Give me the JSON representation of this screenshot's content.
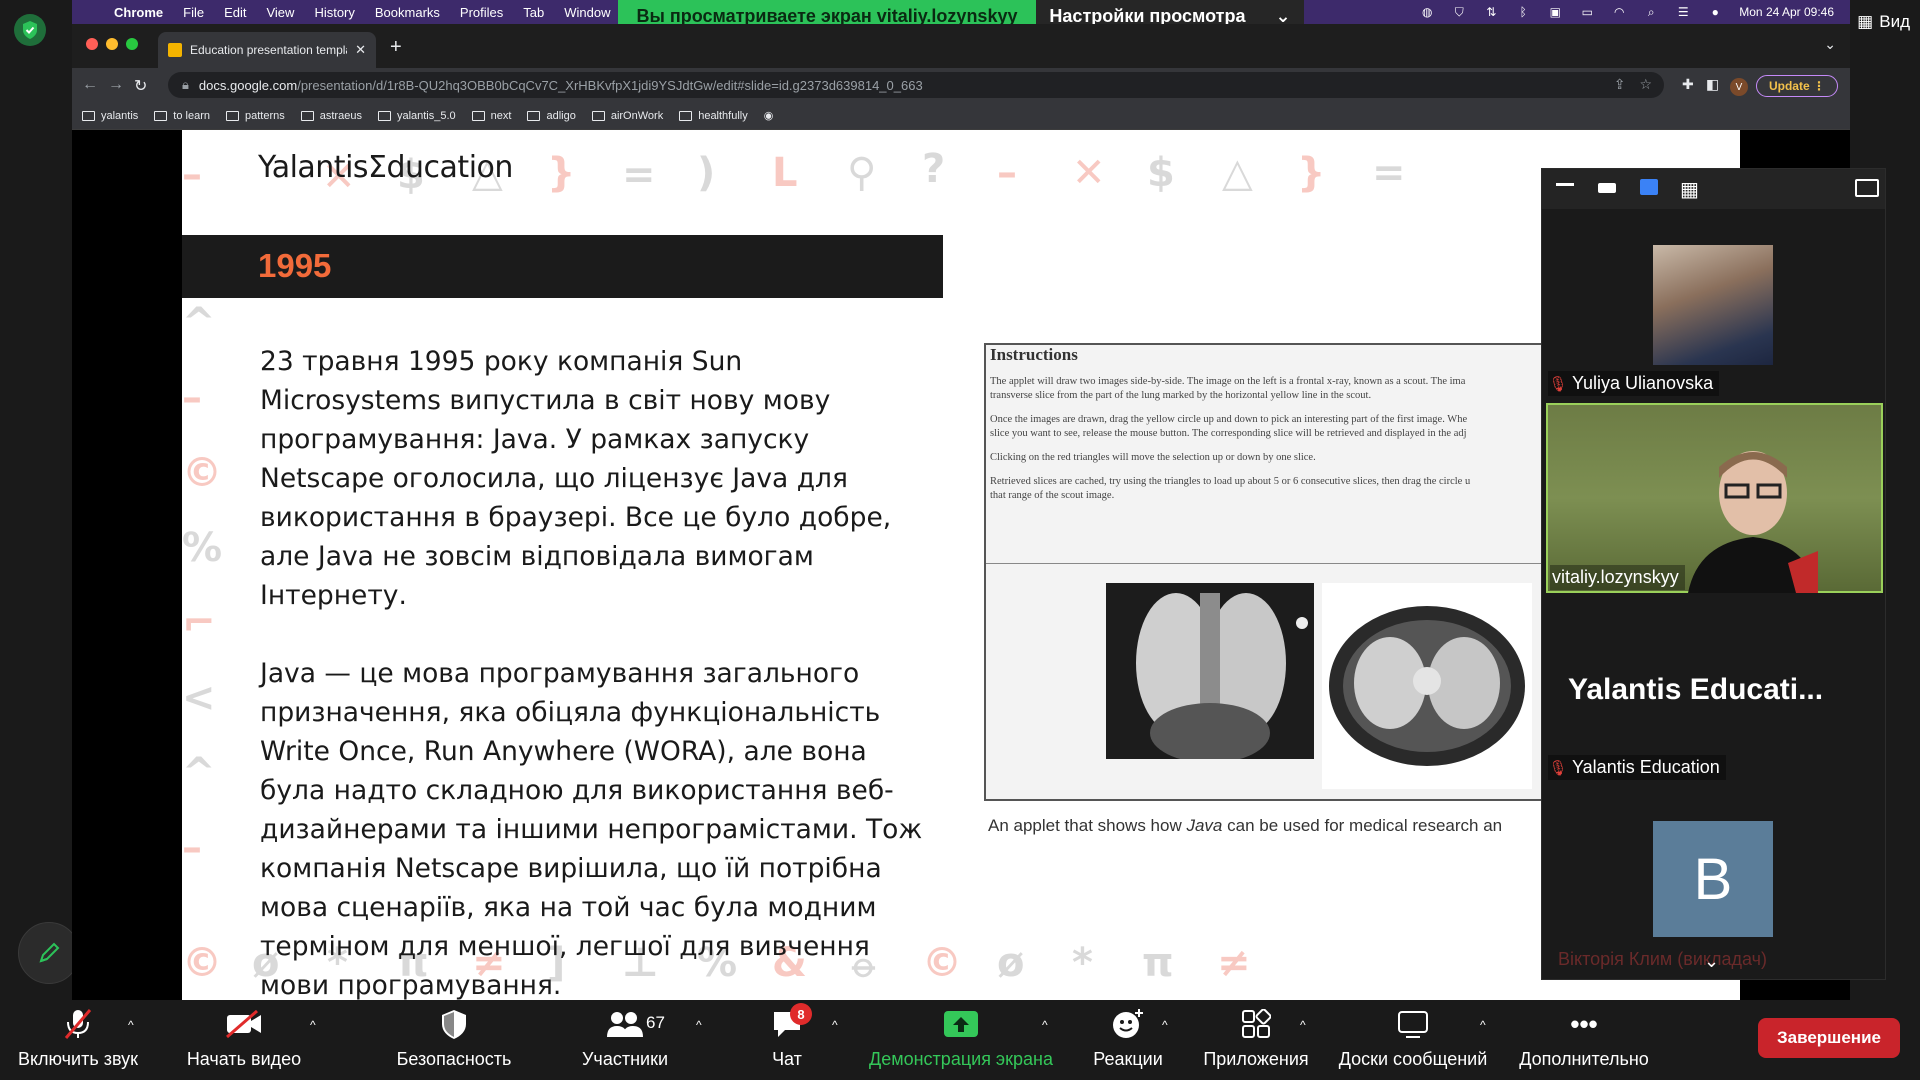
{
  "menubar": {
    "app": "Chrome",
    "items": [
      "File",
      "Edit",
      "View",
      "History",
      "Bookmarks",
      "Profiles",
      "Tab",
      "Window"
    ],
    "datetime": "Mon 24 Apr  09:46"
  },
  "zoom_top": {
    "share_banner": "Вы просматриваете экран vitaliy.lozynskyy",
    "view_settings": "Настройки просмотра",
    "view_button": "Вид"
  },
  "chrome": {
    "tab_title": "Education presentation templa",
    "url_host": "docs.google.com",
    "url_path": "/presentation/d/1r8B-QU2hq3OBB0bCqCv7C_XrHBKvfpX1jdi9YSJdtGw/edit#slide=id.g2373d639814_0_663",
    "profile_letter": "V",
    "update_label": "Update",
    "bookmarks": [
      "yalantis",
      "to learn",
      "patterns",
      "astraeus",
      "yalantis_5.0",
      "next",
      "adligo",
      "airOnWork",
      "healthfully"
    ]
  },
  "slide": {
    "logo": "YalantisΣducation",
    "year": "1995",
    "paragraphs": [
      "23 травня 1995 року компанія Sun Microsystems випустила в світ нову мову програмування: Java. У рамках запуску Netscape оголосила, що ліцензує Java для використання в браузері. Все це було добре, але Java не зовсім відповідала вимогам Інтернету.",
      "Java — це мова програмування загального призначення, яка обіцяла функціональність Write Once, Run Anywhere (WORA), але вона була надто складною для використання веб-дизайнерами та іншими непрограмістами. Тож компанія Netscape вирішила, що їй потрібна мова сценаріїв, яка на той час була модним терміном для меншої, легшої для вивчення мови програмування."
    ],
    "applet": {
      "title": "Instructions",
      "lines": [
        "The applet will draw two images side-by-side. The image on the left is a frontal x-ray, known as a scout. The ima",
        "transverse slice from the part of the lung marked by the horizontal yellow line in the scout.",
        "Once the images are drawn, drag the yellow circle up and down to pick an interesting part of the first image. Whe",
        "slice you want to see, release the mouse button. The corresponding slice will be retrieved and displayed in the adj",
        "Clicking on the red triangles will move the selection up or down by one slice.",
        "Retrieved slices are cached, try using the triangles to load up about 5 or 6 consecutive slices, then drag the circle u",
        "that range of the scout image."
      ],
      "caption_pre": "An applet that shows how ",
      "caption_em": "Java",
      "caption_post": " can be used for medical research an"
    }
  },
  "participants": [
    {
      "name": "Yuliya Ulianovska",
      "muted": true
    },
    {
      "name": "vitaliy.lozynskyy",
      "muted": false
    },
    {
      "name": "Yalantis Education",
      "muted": true,
      "tile_label": "Yalantis  Educati..."
    },
    {
      "name": "Вікторія Клим (викладач)",
      "muted": true,
      "avatar_letter": "B"
    }
  ],
  "toolbar": {
    "unmute": "Включить звук",
    "start_video": "Начать видео",
    "security": "Безопасность",
    "participants": "Участники",
    "participants_count": "67",
    "chat": "Чат",
    "chat_badge": "8",
    "share": "Демонстрация экрана",
    "reactions": "Реакции",
    "apps": "Приложения",
    "whiteboards": "Доски сообщений",
    "more": "Дополнительно",
    "end": "Завершение"
  },
  "colors": {
    "share_green": "#2cc259",
    "accent_orange": "#f26b3a",
    "end_red": "#c9242b",
    "active_speaker": "#9ad05a"
  }
}
